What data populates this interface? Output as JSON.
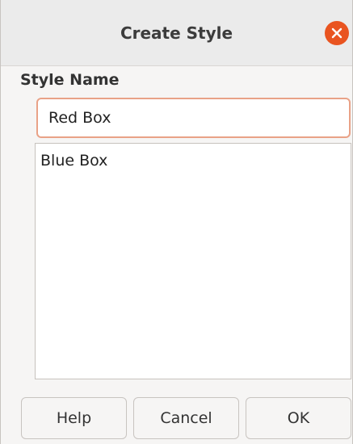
{
  "window": {
    "title": "Create Style",
    "close_icon": "close-icon",
    "accent_color": "#e95420"
  },
  "form": {
    "style_name_label": "Style Name",
    "style_name_value": "Red Box",
    "existing_styles": [
      "Blue Box"
    ]
  },
  "buttons": {
    "help_label": "Help",
    "cancel_label": "Cancel",
    "ok_label": "OK"
  }
}
